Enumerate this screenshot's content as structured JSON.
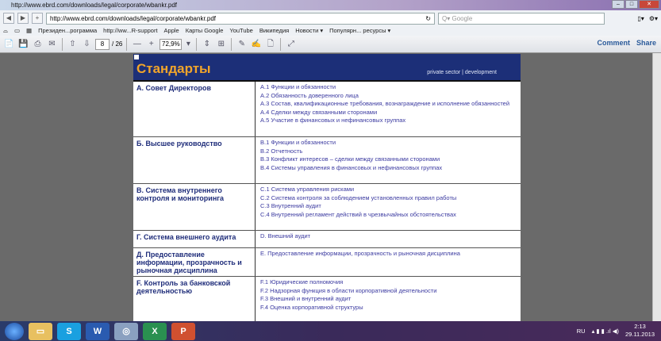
{
  "window": {
    "title": "http://www.ebrd.com/downloads/legal/corporate/wbankr.pdf"
  },
  "nav": {
    "url": "http://www.ebrd.com/downloads/legal/corporate/wbankr.pdf",
    "search_placeholder": "Google"
  },
  "bookmarks": [
    "Президен...рограмма",
    "http://ww...R-support",
    "Apple",
    "Карты Google",
    "YouTube",
    "Википедия",
    "Новости ▾",
    "Популярн... ресурсы ▾"
  ],
  "pdf_toolbar": {
    "page": "8",
    "total": "/ 26",
    "zoom": "72,9%",
    "comment": "Comment",
    "share": "Share"
  },
  "document": {
    "title": "Стандарты",
    "subtitle": "private sector | development",
    "rows": [
      {
        "label": "А.    Совет Директоров",
        "items": [
          "А.1 Функции и обязанности",
          "А.2 Обязанность доверенного лица",
          "А.3 Состав, квалификационные требования, вознаграждение  и исполнение обязанностей",
          "А.4 Сделки между связанными сторонами",
          "А.5 Участие в финансовых и нефинансовых группах"
        ]
      },
      {
        "label": "Б. Высшее руководство",
        "items": [
          "В.1 Функции и обязанности",
          "В.2 Отчетность",
          "В.3 Конфликт интересов – сделки между связанными сторонами",
          "В.4 Системы управления в финансовых и нефинансовых группах"
        ]
      },
      {
        "label": "В. Система внутреннего контроля и мониторинга",
        "items": [
          "С.1 Система управления рисками",
          "С.2 Система контроля за соблюдением установленных правил работы",
          "С.3 Внутренний аудит",
          "С.4 Внутренний регламент действий в чрезвычайных обстоятельствах"
        ]
      },
      {
        "label": "Г. Система внешнего аудита",
        "items": [
          "D. Внешний аудит"
        ]
      },
      {
        "label": "Д. Предоставление информации, прозрачность и рыночная дисциплина",
        "items": [
          "E. Предоставление информации, прозрачность и рыночная дисциплина"
        ]
      },
      {
        "label": "F. Контроль за банковской деятельностью",
        "items": [
          "F.1 Юридические полномочия",
          "F.2 Надзорная функция в области корпоративной деятельности",
          "F.3 Внешний и внутренний аудит",
          "F.4 Оценка корпоративной структуры"
        ]
      }
    ]
  },
  "taskbar": {
    "apps": [
      "explorer",
      "skype",
      "word",
      "safari",
      "excel",
      "powerpoint"
    ],
    "lang": "RU",
    "time": "2:13",
    "date": "29.11.2013"
  }
}
